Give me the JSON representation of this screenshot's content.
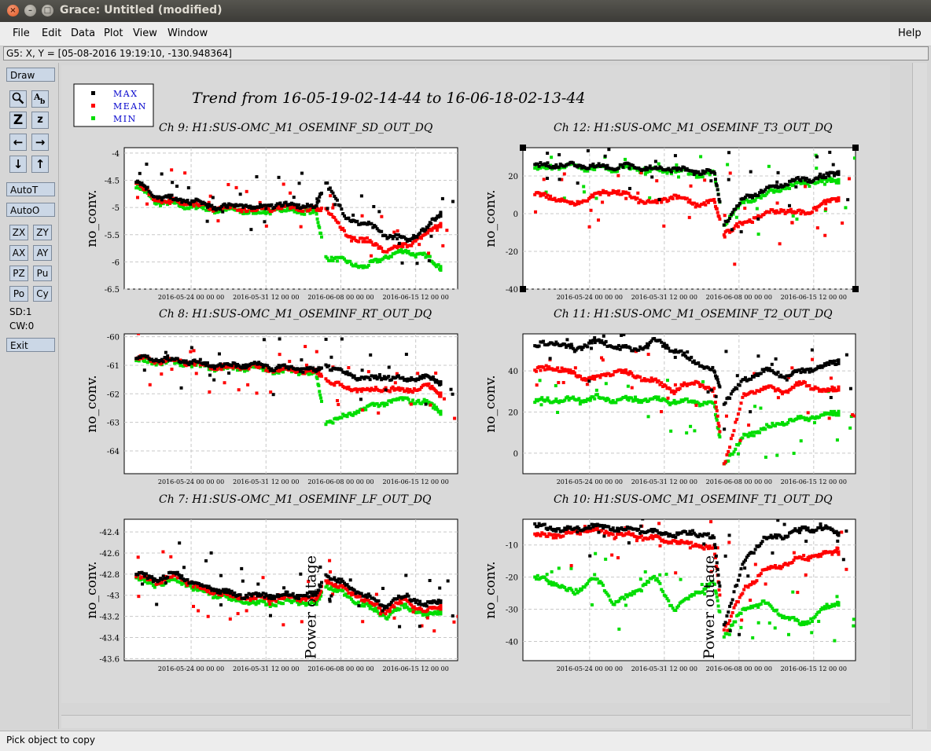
{
  "window": {
    "title": "Grace: Untitled (modified)",
    "close_glyph": "×",
    "minimize_glyph": "–",
    "maximize_glyph": "□"
  },
  "menu": {
    "file": "File",
    "edit": "Edit",
    "data": "Data",
    "plot": "Plot",
    "view": "View",
    "window": "Window",
    "help": "Help"
  },
  "coord_readout": "G5: X, Y = [05-08-2016 19:19:10, -130.948364]",
  "toolbar": {
    "draw": "Draw",
    "zoom_icon": "magnifier-icon",
    "text_icon": "text-icon",
    "z_big": "Z",
    "z_small": "z",
    "left_icon": "←",
    "right_icon": "→",
    "down_icon": "↓",
    "up_icon": "↑",
    "autot": "AutoT",
    "autoo": "AutoO",
    "zx": "ZX",
    "zy": "ZY",
    "ax": "AX",
    "ay": "AY",
    "pz": "PZ",
    "pu": "Pu",
    "po": "Po",
    "cy": "Cy",
    "sd": "SD:1",
    "cw": "CW:0",
    "exit": "Exit"
  },
  "status": "Pick object to copy",
  "figure": {
    "title": "Trend from 16-05-19-02-14-44 to 16-06-18-02-13-44",
    "legend": [
      {
        "label": "MAX",
        "color": "#000000"
      },
      {
        "label": "MEAN",
        "color": "#ff0000"
      },
      {
        "label": "MIN",
        "color": "#00dd00"
      }
    ],
    "label_color": "#0000cc"
  },
  "chart_data": [
    {
      "type": "scatter",
      "title": "Ch 9: H1:SUS-OMC_M1_OSEMINF_SD_OUT_DQ",
      "ylabel": "no_conv.",
      "ylim": [
        -6.5,
        -3.9
      ],
      "yticks": [
        "-4",
        "-4.5",
        "-5",
        "-5.5",
        "-6",
        "-6.5"
      ],
      "xticks": [
        "2016-05-24 00 00 00",
        "2016-05-31 12 00 00",
        "2016-06-08 00 00 00",
        "2016-06-15 12 00 00"
      ],
      "series": [
        {
          "name": "MAX",
          "x": [
            0,
            2,
            4,
            6,
            8,
            10,
            12,
            14,
            16,
            18,
            19,
            21,
            23,
            25,
            27,
            29,
            30.5
          ],
          "y": [
            -4.5,
            -4.8,
            -4.85,
            -4.9,
            -5.0,
            -4.95,
            -5.0,
            -4.95,
            -4.95,
            -5.0,
            -4.5,
            -5.2,
            -5.3,
            -5.5,
            -5.6,
            -5.4,
            -5.1
          ]
        },
        {
          "name": "MEAN",
          "x": [
            0,
            2,
            4,
            6,
            8,
            10,
            12,
            14,
            16,
            18,
            19,
            21,
            23,
            25,
            27,
            29,
            30.5
          ],
          "y": [
            -4.55,
            -4.85,
            -4.9,
            -4.95,
            -5.02,
            -5.0,
            -5.05,
            -5.0,
            -5.0,
            -5.05,
            -5.0,
            -5.5,
            -5.6,
            -5.8,
            -5.7,
            -5.5,
            -5.3
          ]
        },
        {
          "name": "MIN",
          "x": [
            0,
            2,
            4,
            6,
            8,
            10,
            12,
            14,
            16,
            18,
            19,
            21,
            23,
            25,
            27,
            29,
            30.5
          ],
          "y": [
            -4.6,
            -4.9,
            -4.95,
            -5.0,
            -5.05,
            -5.05,
            -5.1,
            -5.05,
            -5.05,
            -5.1,
            -5.9,
            -6.0,
            -6.1,
            -5.9,
            -5.8,
            -5.9,
            -6.1
          ]
        }
      ]
    },
    {
      "type": "scatter",
      "title": "Ch 12: H1:SUS-OMC_M1_OSEMINF_T3_OUT_DQ",
      "ylabel": "no_conv.",
      "ylim": [
        -40,
        35
      ],
      "yticks": [
        "20",
        "0",
        "-20",
        "-40"
      ],
      "xticks": [
        "2016-05-24 00 00 00",
        "2016-05-31 12 00 00",
        "2016-06-08 00 00 00",
        "2016-06-15 12 00 00"
      ],
      "series": [
        {
          "name": "MAX",
          "x": [
            0,
            2,
            4,
            6,
            8,
            10,
            12,
            14,
            16,
            18,
            19,
            21,
            23,
            25,
            27,
            29,
            30.5
          ],
          "y": [
            25,
            26,
            26,
            25,
            25,
            25,
            24,
            24,
            22,
            22,
            -5,
            8,
            12,
            16,
            18,
            19,
            22
          ]
        },
        {
          "name": "MEAN",
          "x": [
            0,
            2,
            4,
            6,
            8,
            10,
            12,
            14,
            16,
            18,
            19,
            21,
            23,
            25,
            27,
            29,
            30.5
          ],
          "y": [
            10,
            8,
            5,
            10,
            12,
            8,
            5,
            10,
            5,
            6,
            -10,
            -5,
            0,
            2,
            0,
            5,
            8
          ]
        },
        {
          "name": "MIN",
          "x": [
            0,
            2,
            4,
            6,
            8,
            10,
            12,
            14,
            16,
            18,
            19,
            21,
            23,
            25,
            27,
            29,
            30.5
          ],
          "y": [
            24,
            25,
            25,
            24,
            24,
            24,
            23,
            23,
            21,
            21,
            -5,
            6,
            10,
            14,
            16,
            17,
            18
          ]
        }
      ]
    },
    {
      "type": "scatter",
      "title": "Ch 8: H1:SUS-OMC_M1_OSEMINF_RT_OUT_DQ",
      "ylabel": "no_conv.",
      "ylim": [
        -64.8,
        -59.9
      ],
      "yticks": [
        "-60",
        "-61",
        "-62",
        "-63",
        "-64"
      ],
      "xticks": [
        "2016-05-24 00 00 00",
        "2016-05-31 12 00 00",
        "2016-06-08 00 00 00",
        "2016-06-15 12 00 00"
      ],
      "series": [
        {
          "name": "MAX",
          "x": [
            0,
            2,
            4,
            6,
            8,
            10,
            12,
            14,
            16,
            18,
            19,
            21,
            23,
            25,
            27,
            29,
            30.5
          ],
          "y": [
            -60.7,
            -60.8,
            -60.8,
            -60.9,
            -61.0,
            -61.0,
            -61.0,
            -61.1,
            -61.1,
            -61.2,
            -61.0,
            -61.3,
            -61.5,
            -61.4,
            -61.5,
            -61.4,
            -61.6
          ]
        },
        {
          "name": "MEAN",
          "x": [
            0,
            2,
            4,
            6,
            8,
            10,
            12,
            14,
            16,
            18,
            19,
            21,
            23,
            25,
            27,
            29,
            30.5
          ],
          "y": [
            -60.75,
            -60.85,
            -60.85,
            -60.95,
            -61.05,
            -61.05,
            -61.05,
            -61.15,
            -61.15,
            -61.25,
            -61.5,
            -61.8,
            -61.9,
            -61.8,
            -61.9,
            -61.7,
            -62.0
          ]
        },
        {
          "name": "MIN",
          "x": [
            0,
            2,
            4,
            6,
            8,
            10,
            12,
            14,
            16,
            18,
            19,
            21,
            23,
            25,
            27,
            29,
            30.5
          ],
          "y": [
            -60.8,
            -60.9,
            -60.9,
            -61.0,
            -61.1,
            -61.1,
            -61.1,
            -61.2,
            -61.2,
            -61.3,
            -63.0,
            -62.8,
            -62.5,
            -62.3,
            -62.2,
            -62.3,
            -62.6
          ]
        }
      ]
    },
    {
      "type": "scatter",
      "title": "Ch 11: H1:SUS-OMC_M1_OSEMINF_T2_OUT_DQ",
      "ylabel": "no_conv.",
      "ylim": [
        -10,
        58
      ],
      "yticks": [
        "40",
        "20",
        "0"
      ],
      "xticks": [
        "2016-05-24 00 00 00",
        "2016-05-31 12 00 00",
        "2016-06-08 00 00 00",
        "2016-06-15 12 00 00"
      ],
      "series": [
        {
          "name": "MAX",
          "x": [
            0,
            2,
            4,
            6,
            8,
            10,
            12,
            14,
            16,
            18,
            19,
            21,
            23,
            25,
            27,
            29,
            30.5
          ],
          "y": [
            52,
            54,
            50,
            55,
            52,
            50,
            55,
            50,
            45,
            40,
            25,
            35,
            40,
            38,
            40,
            42,
            45
          ]
        },
        {
          "name": "MEAN",
          "x": [
            0,
            2,
            4,
            6,
            8,
            10,
            12,
            14,
            16,
            18,
            19,
            21,
            23,
            25,
            27,
            29,
            30.5
          ],
          "y": [
            40,
            42,
            38,
            36,
            40,
            38,
            35,
            30,
            35,
            30,
            -5,
            28,
            32,
            30,
            34,
            30,
            32
          ]
        },
        {
          "name": "MIN",
          "x": [
            0,
            2,
            4,
            6,
            8,
            10,
            12,
            14,
            16,
            18,
            19,
            21,
            23,
            25,
            27,
            29,
            30.5
          ],
          "y": [
            25,
            26,
            26,
            27,
            26,
            26,
            26,
            25,
            25,
            23,
            -5,
            8,
            12,
            15,
            17,
            18,
            20
          ]
        }
      ]
    },
    {
      "type": "scatter",
      "title": "Ch 7: H1:SUS-OMC_M1_OSEMINF_LF_OUT_DQ",
      "ylabel": "no_conv.",
      "ylim": [
        -43.62,
        -42.28
      ],
      "yticks": [
        "-42.4",
        "-42.6",
        "-42.8",
        "-43",
        "-43.2",
        "-43.4",
        "-43.6"
      ],
      "xticks": [
        "2016-05-24 00 00 00",
        "2016-05-31 12 00 00",
        "2016-06-08 00 00 00",
        "2016-06-15 12 00 00"
      ],
      "annotation": "Power outage",
      "series": [
        {
          "name": "MAX",
          "x": [
            0,
            2,
            4,
            6,
            8,
            10,
            12,
            14,
            16,
            18,
            19,
            21,
            23,
            25,
            27,
            29,
            30.5
          ],
          "y": [
            -42.8,
            -42.85,
            -42.8,
            -42.9,
            -42.95,
            -43.0,
            -43.0,
            -43.0,
            -43.0,
            -43.0,
            -42.8,
            -42.9,
            -43.0,
            -43.1,
            -43.0,
            -43.1,
            -43.05
          ]
        },
        {
          "name": "MEAN",
          "x": [
            0,
            2,
            4,
            6,
            8,
            10,
            12,
            14,
            16,
            18,
            19,
            21,
            23,
            25,
            27,
            29,
            30.5
          ],
          "y": [
            -42.82,
            -42.87,
            -42.82,
            -42.92,
            -42.97,
            -43.02,
            -43.03,
            -43.03,
            -43.02,
            -43.05,
            -42.85,
            -42.95,
            -43.05,
            -43.15,
            -43.05,
            -43.15,
            -43.1
          ]
        },
        {
          "name": "MIN",
          "x": [
            0,
            2,
            4,
            6,
            8,
            10,
            12,
            14,
            16,
            18,
            19,
            21,
            23,
            25,
            27,
            29,
            30.5
          ],
          "y": [
            -42.85,
            -42.9,
            -42.85,
            -42.95,
            -43.0,
            -43.05,
            -43.08,
            -43.08,
            -43.05,
            -43.1,
            -42.9,
            -43.0,
            -43.1,
            -43.2,
            -43.1,
            -43.2,
            -43.15
          ]
        }
      ]
    },
    {
      "type": "scatter",
      "title": "Ch 10: H1:SUS-OMC_M1_OSEMINF_T1_OUT_DQ",
      "ylabel": "no_conv.",
      "ylim": [
        -46,
        -2
      ],
      "yticks": [
        "-10",
        "-20",
        "-30",
        "-40"
      ],
      "xticks": [
        "2016-05-24 00 00 00",
        "2016-05-31 12 00 00",
        "2016-06-08 00 00 00",
        "2016-06-15 12 00 00"
      ],
      "annotation": "Power outage",
      "series": [
        {
          "name": "MAX",
          "x": [
            0,
            2,
            4,
            6,
            8,
            10,
            12,
            14,
            16,
            18,
            19,
            21,
            23,
            25,
            27,
            29,
            30.5
          ],
          "y": [
            -4,
            -5,
            -5,
            -4,
            -5,
            -5,
            -6,
            -7,
            -6,
            -8,
            -35,
            -15,
            -8,
            -7,
            -5,
            -5,
            -6
          ]
        },
        {
          "name": "MEAN",
          "x": [
            0,
            2,
            4,
            6,
            8,
            10,
            12,
            14,
            16,
            18,
            19,
            21,
            23,
            25,
            27,
            29,
            30.5
          ],
          "y": [
            -7,
            -7,
            -6,
            -5,
            -7,
            -7,
            -8,
            -9,
            -10,
            -11,
            -36,
            -24,
            -18,
            -16,
            -14,
            -13,
            -12
          ]
        },
        {
          "name": "MIN",
          "x": [
            0,
            2,
            4,
            6,
            8,
            10,
            12,
            14,
            16,
            18,
            19,
            21,
            23,
            25,
            27,
            29,
            30.5
          ],
          "y": [
            -20,
            -22,
            -25,
            -20,
            -28,
            -25,
            -20,
            -30,
            -25,
            -22,
            -38,
            -30,
            -28,
            -32,
            -35,
            -30,
            -28
          ]
        }
      ]
    }
  ]
}
